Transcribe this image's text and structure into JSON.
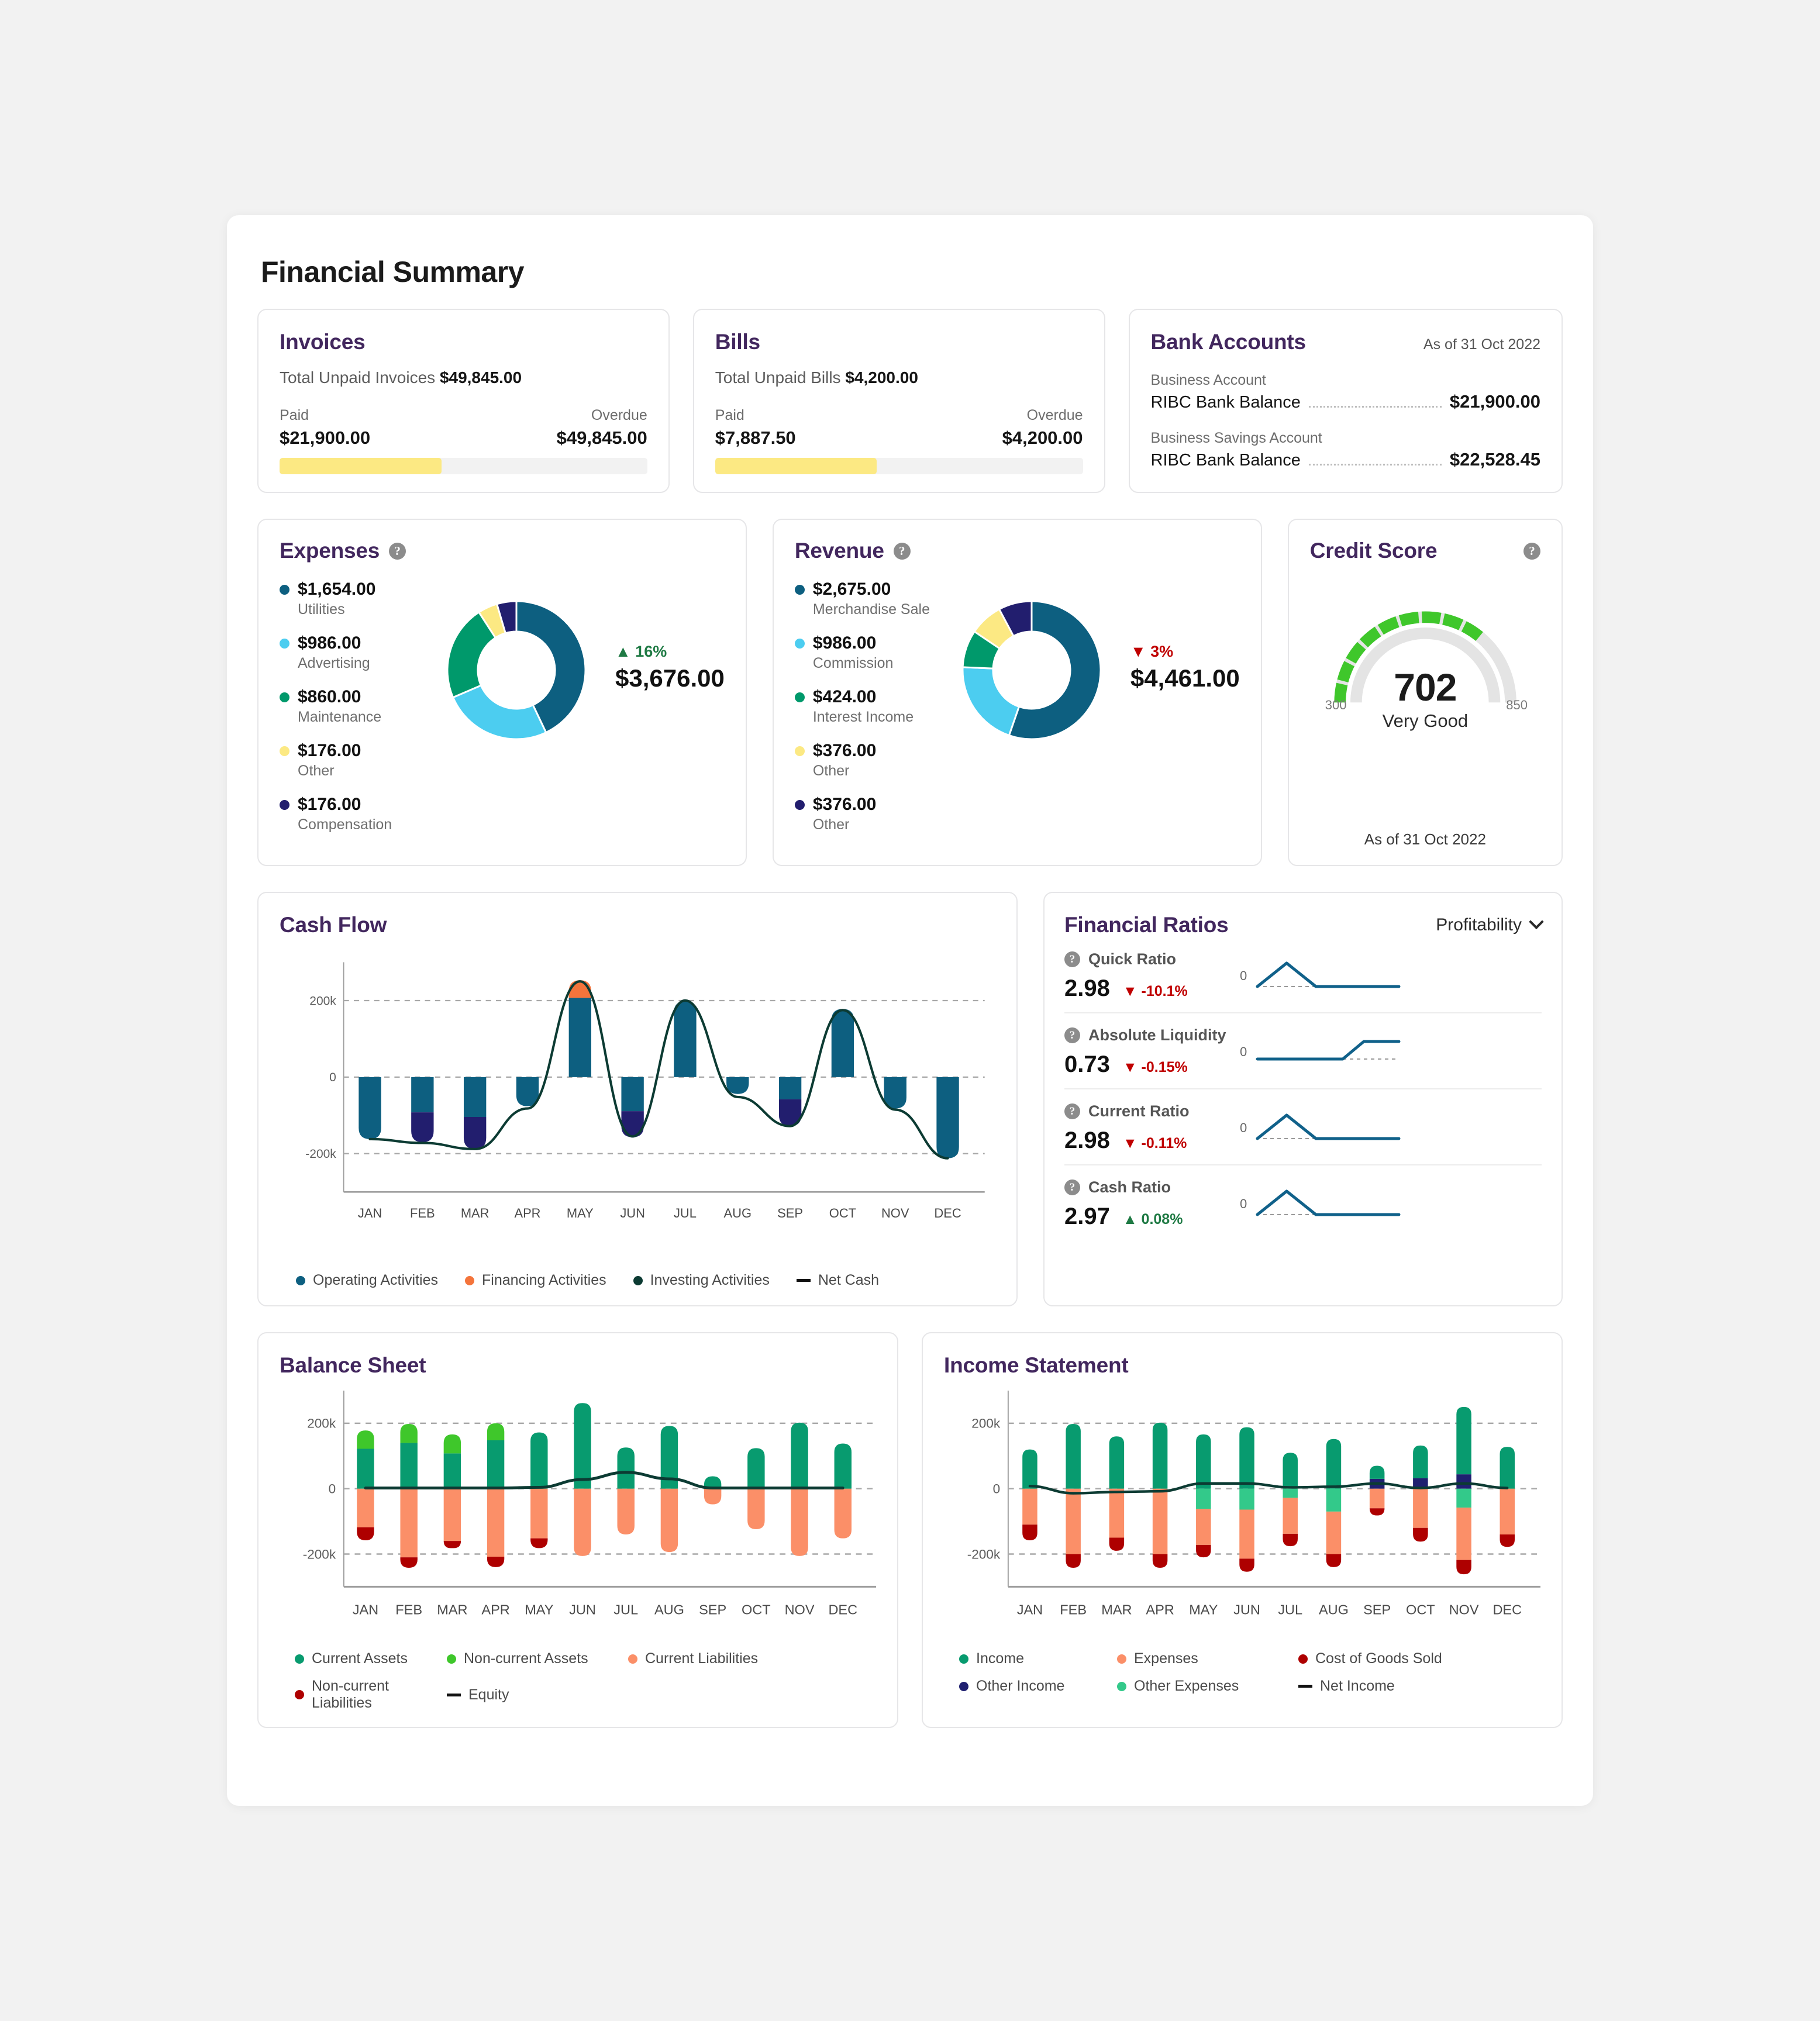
{
  "page": {
    "title": "Financial Summary"
  },
  "colors": {
    "title_purple": "#42275e",
    "teal": "#0d5f80",
    "light_blue": "#4ccdf0",
    "green": "#00996b",
    "yellow": "#fce983",
    "navy": "#221e6e",
    "salmon": "#fb8f68",
    "dark_red": "#ae0000",
    "bright_green": "#3fc72b",
    "emerald": "#089b6f",
    "mint": "#33c98a",
    "dark_ink": "#0c3b33",
    "gauge_green": "#3fc72b",
    "gauge_track": "#e2e2e2",
    "spark_blue": "#10618a",
    "up_green": "#1f7a44",
    "down_red": "#c00000"
  },
  "invoices": {
    "title": "Invoices",
    "total_label": "Total Unpaid Invoices",
    "total_value": "$49,845.00",
    "paid_label": "Paid",
    "paid_value": "$21,900.00",
    "overdue_label": "Overdue",
    "overdue_value": "$49,845.00",
    "progress_pct": 44
  },
  "bills": {
    "title": "Bills",
    "total_label": "Total Unpaid Bills",
    "total_value": "$4,200.00",
    "paid_label": "Paid",
    "paid_value": "$7,887.50",
    "overdue_label": "Overdue",
    "overdue_value": "$4,200.00",
    "progress_pct": 44
  },
  "bank": {
    "title": "Bank Accounts",
    "as_of": "As of 31 Oct 2022",
    "accounts": [
      {
        "name": "Business Account",
        "label": "RIBC Bank Balance",
        "amount": "$21,900.00"
      },
      {
        "name": "Business Savings Account",
        "label": "RIBC Bank Balance",
        "amount": "$22,528.45"
      }
    ]
  },
  "expenses": {
    "title": "Expenses",
    "change_pct": "16%",
    "change_dir": "up",
    "total": "$3,676.00",
    "items": [
      {
        "amount": "$1,654.00",
        "category": "Utilities",
        "color": "#0d5f80",
        "value": 1654
      },
      {
        "amount": "$986.00",
        "category": "Advertising",
        "color": "#4ccdf0",
        "value": 986
      },
      {
        "amount": "$860.00",
        "category": "Maintenance",
        "color": "#00996b",
        "value": 860
      },
      {
        "amount": "$176.00",
        "category": "Other",
        "color": "#fce983",
        "value": 176
      },
      {
        "amount": "$176.00",
        "category": "Compensation",
        "color": "#221e6e",
        "value": 176
      }
    ]
  },
  "revenue": {
    "title": "Revenue",
    "change_pct": "3%",
    "change_dir": "down",
    "total": "$4,461.00",
    "items": [
      {
        "amount": "$2,675.00",
        "category": "Merchandise Sale",
        "color": "#0d5f80",
        "value": 2675
      },
      {
        "amount": "$986.00",
        "category": "Commission",
        "color": "#4ccdf0",
        "value": 986
      },
      {
        "amount": "$424.00",
        "category": "Interest Income",
        "color": "#00996b",
        "value": 424
      },
      {
        "amount": "$376.00",
        "category": "Other",
        "color": "#fce983",
        "value": 376
      },
      {
        "amount": "$376.00",
        "category": "Other",
        "color": "#221e6e",
        "value": 376
      }
    ]
  },
  "credit_score": {
    "title": "Credit Score",
    "score": "702",
    "rating": "Very Good",
    "min": "300",
    "max": "850",
    "as_of": "As of 31 Oct 2022"
  },
  "cash_flow": {
    "title": "Cash Flow"
  },
  "financial_ratios": {
    "title": "Financial Ratios",
    "selected": "Profitability",
    "zero_label": "0",
    "rows": [
      {
        "name": "Quick Ratio",
        "value": "2.98",
        "delta": "-10.1%",
        "dir": "down",
        "spark": "peak"
      },
      {
        "name": "Absolute Liquidity",
        "value": "0.73",
        "delta": "-0.15%",
        "dir": "down",
        "spark": "step"
      },
      {
        "name": "Current Ratio",
        "value": "2.98",
        "delta": "-0.11%",
        "dir": "down",
        "spark": "peak"
      },
      {
        "name": "Cash Ratio",
        "value": "2.97",
        "delta": "0.08%",
        "dir": "up",
        "spark": "peak"
      }
    ]
  },
  "balance_sheet": {
    "title": "Balance Sheet"
  },
  "income_statement": {
    "title": "Income Statement"
  },
  "chart_data": [
    {
      "type": "bar",
      "name": "cash_flow",
      "title": "Cash Flow",
      "categories": [
        "JAN",
        "FEB",
        "MAR",
        "APR",
        "MAY",
        "JUN",
        "JUL",
        "AUG",
        "SEP",
        "OCT",
        "NOV",
        "DEC"
      ],
      "ylim": [
        -300000,
        300000
      ],
      "ytick_labels": [
        "200k",
        "0",
        "-200k"
      ],
      "yticks": [
        200000,
        0,
        -200000
      ],
      "grid": true,
      "legend_position": "bottom",
      "series": [
        {
          "name": "Operating Activities",
          "color": "#0d5f80",
          "values": [
            -162000,
            -92000,
            -104000,
            -76000,
            207000,
            -89000,
            198000,
            -44000,
            -58000,
            178000,
            -82000,
            -212000
          ]
        },
        {
          "name": "Financing Activities",
          "color": "#f4743b",
          "values": [
            0,
            0,
            0,
            0,
            46000,
            0,
            0,
            0,
            0,
            0,
            0,
            0
          ]
        },
        {
          "name": "Investing Activities",
          "color": "#221e6e",
          "values": [
            0,
            -78000,
            -84000,
            0,
            0,
            -68000,
            0,
            0,
            -70000,
            0,
            0,
            0
          ]
        },
        {
          "name": "Net Cash",
          "color": "#0c3b33",
          "type": "line",
          "values": [
            -162000,
            -172000,
            -188000,
            -82000,
            250000,
            -155000,
            200000,
            -52000,
            -128000,
            175000,
            -85000,
            -212000
          ]
        }
      ]
    },
    {
      "type": "bar",
      "name": "balance_sheet",
      "title": "Balance Sheet",
      "categories": [
        "JAN",
        "FEB",
        "MAR",
        "APR",
        "MAY",
        "JUN",
        "JUL",
        "AUG",
        "SEP",
        "OCT",
        "NOV",
        "DEC"
      ],
      "ylim": [
        -300000,
        300000
      ],
      "ytick_labels": [
        "200k",
        "0",
        "-200k"
      ],
      "yticks": [
        200000,
        0,
        -200000
      ],
      "grid": true,
      "legend_position": "bottom",
      "series": [
        {
          "name": "Current Assets",
          "color": "#089b6f",
          "values": [
            122000,
            140000,
            108000,
            148000,
            172000,
            262000,
            126000,
            192000,
            38000,
            124000,
            202000,
            138000
          ]
        },
        {
          "name": "Non-current Assets",
          "color": "#3fc72b",
          "values": [
            56000,
            58000,
            58000,
            52000,
            0,
            0,
            0,
            0,
            0,
            0,
            0,
            0
          ]
        },
        {
          "name": "Current Liabilities",
          "color": "#fb8f68",
          "values": [
            -118000,
            -210000,
            -160000,
            -208000,
            -152000,
            -206000,
            -140000,
            -194000,
            -48000,
            -124000,
            -206000,
            -152000
          ]
        },
        {
          "name": "Non-current Liabilities",
          "color": "#ae0000",
          "values": [
            -40000,
            -32000,
            -22000,
            -32000,
            -30000,
            0,
            0,
            0,
            0,
            0,
            0,
            0
          ]
        },
        {
          "name": "Equity",
          "color": "#0c3b33",
          "type": "line",
          "values": [
            2000,
            2000,
            2000,
            2000,
            4000,
            28000,
            50000,
            30000,
            2000,
            2000,
            2000,
            2000
          ]
        }
      ]
    },
    {
      "type": "bar",
      "name": "income_statement",
      "title": "Income Statement",
      "categories": [
        "JAN",
        "FEB",
        "MAR",
        "APR",
        "MAY",
        "JUN",
        "JUL",
        "AUG",
        "SEP",
        "OCT",
        "NOV",
        "DEC"
      ],
      "ylim": [
        -300000,
        300000
      ],
      "ytick_labels": [
        "200k",
        "0",
        "-200k"
      ],
      "yticks": [
        200000,
        0,
        -200000
      ],
      "grid": true,
      "legend_position": "bottom",
      "series": [
        {
          "name": "Income",
          "color": "#089b6f",
          "values": [
            120000,
            198000,
            160000,
            202000,
            166000,
            188000,
            110000,
            152000,
            40000,
            100000,
            206000,
            128000
          ]
        },
        {
          "name": "Other Income",
          "color": "#1f2070",
          "values": [
            0,
            0,
            0,
            0,
            0,
            0,
            0,
            0,
            30000,
            32000,
            44000,
            0
          ]
        },
        {
          "name": "Other Expenses",
          "color": "#33c98a",
          "values": [
            0,
            0,
            0,
            0,
            -62000,
            -64000,
            -28000,
            -70000,
            0,
            0,
            -58000,
            0
          ]
        },
        {
          "name": "Expenses",
          "color": "#fb8f68",
          "values": [
            -110000,
            -200000,
            -150000,
            -200000,
            -110000,
            -150000,
            -110000,
            -130000,
            -60000,
            -120000,
            -160000,
            -140000
          ]
        },
        {
          "name": "Cost of Goods Sold",
          "color": "#ae0000",
          "values": [
            -48000,
            -42000,
            -40000,
            -42000,
            -38000,
            -40000,
            -38000,
            -40000,
            -22000,
            -42000,
            -44000,
            -38000
          ]
        },
        {
          "name": "Net Income",
          "color": "#0c3b33",
          "type": "line",
          "values": [
            8000,
            -14000,
            -10000,
            -8000,
            16000,
            16000,
            4000,
            6000,
            16000,
            2000,
            16000,
            2000
          ]
        }
      ]
    }
  ],
  "cf_legend": [
    {
      "label": "Operating Activities",
      "color": "#0d5f80",
      "marker": "dot"
    },
    {
      "label": "Financing Activities",
      "color": "#f4743b",
      "marker": "dot"
    },
    {
      "label": "Investing Activities",
      "color": "#0c3b33",
      "marker": "dot"
    },
    {
      "label": "Net Cash",
      "color": "#111111",
      "marker": "dash"
    }
  ],
  "bs_legend": [
    {
      "label": "Current Assets",
      "color": "#089b6f",
      "marker": "dot"
    },
    {
      "label": "Non-current Assets",
      "color": "#3fc72b",
      "marker": "dot"
    },
    {
      "label": "Current Liabilities",
      "color": "#fb8f68",
      "marker": "dot"
    },
    {
      "label": "Non-current Liabilities",
      "color": "#ae0000",
      "marker": "dot"
    },
    {
      "label": "Equity",
      "color": "#111111",
      "marker": "dash"
    }
  ],
  "is_legend": [
    {
      "label": "Income",
      "color": "#089b6f",
      "marker": "dot"
    },
    {
      "label": "Expenses",
      "color": "#fb8f68",
      "marker": "dot"
    },
    {
      "label": "Cost of Goods Sold",
      "color": "#ae0000",
      "marker": "dot"
    },
    {
      "label": "Other Income",
      "color": "#1f2070",
      "marker": "dot"
    },
    {
      "label": "Other Expenses",
      "color": "#33c98a",
      "marker": "dot"
    },
    {
      "label": "Net Income",
      "color": "#111111",
      "marker": "dash"
    }
  ]
}
